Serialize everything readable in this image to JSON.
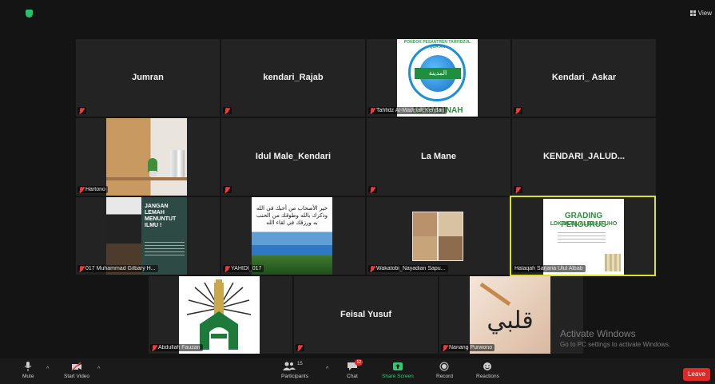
{
  "topbar": {
    "view_label": "View"
  },
  "tiles": {
    "jumran": {
      "name": "Jumran"
    },
    "kendari_rajab": {
      "name": "kendari_Rajab"
    },
    "tahfidz": {
      "label": "Tahfidz Al-Madinah Kendari",
      "logo_top": "PONDOK PESANTREN TAHFIDZUL QUR'AN",
      "logo_arabic": "المدينة",
      "logo_bottom": "AL-MADINAH"
    },
    "kendari_askar": {
      "name": "Kendari_ Askar"
    },
    "hartono": {
      "label": "Hartono"
    },
    "idul": {
      "name": "Idul Male_Kendari"
    },
    "lamane": {
      "name": "La Mane"
    },
    "jalud": {
      "name": "KENDARI_JALUD..."
    },
    "gilbary": {
      "label": "017 Muhammad Gilbary H...",
      "image_text": "JANGAN LEMAH MENUNTUT ILMU !"
    },
    "yahidi": {
      "label": "YAHIDI_017",
      "arabic_text": "خير الأصحاب من أحبك في الله وذكرك بالله وطوقك من الحنب به ورزقك في لقاء الله"
    },
    "wakatobi": {
      "label": "Wakatobi_Nayadian Sapu..."
    },
    "halaqah": {
      "label": "Halaqah Sarjana Ulul Albab",
      "slide_title": "GRADING PENGURUS",
      "slide_subtitle": "LDK ULUL ALBAAB UHO"
    },
    "abdullah": {
      "label": "Abdullah Fauzan"
    },
    "feisal": {
      "name": "Feisal Yusuf"
    },
    "nanang": {
      "label": "Nanang Purwono",
      "image_text": "قلبي"
    }
  },
  "watermark": {
    "line1": "Activate Windows",
    "line2": "Go to PC settings to activate Windows."
  },
  "toolbar": {
    "mute": "Mute",
    "start_video": "Start Video",
    "participants": "Participants",
    "participants_count": "15",
    "chat": "Chat",
    "chat_badge": "12",
    "share_screen": "Share Screen",
    "record": "Record",
    "reactions": "Reactions",
    "leave": "Leave"
  },
  "colors": {
    "active_speaker": "#d7e32b",
    "share_green": "#2ecc71",
    "leave_red": "#e02828",
    "muted_red": "#e0383b"
  }
}
